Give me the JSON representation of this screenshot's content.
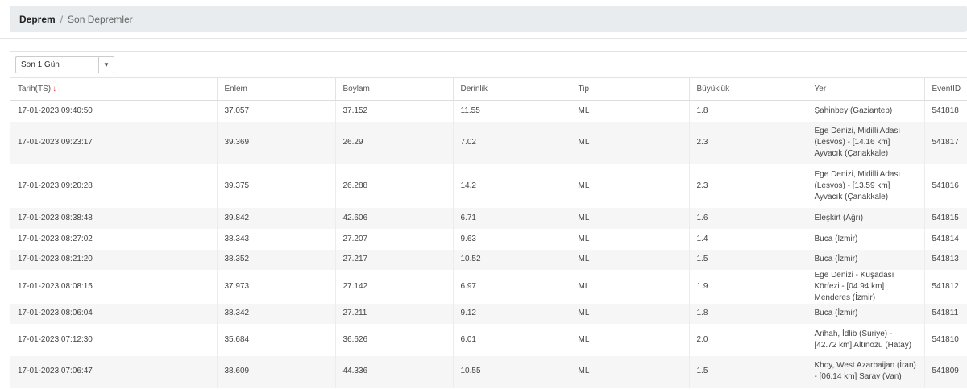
{
  "breadcrumb": {
    "home": "Deprem",
    "separator": "/",
    "current": "Son Depremler"
  },
  "filter": {
    "selected": "Son 1 Gün"
  },
  "table": {
    "columns": [
      "Tarih(TS)",
      "Enlem",
      "Boylam",
      "Derinlik",
      "Tip",
      "Büyüklük",
      "Yer",
      "EventID"
    ],
    "sort_indicator": "↓",
    "rows": [
      [
        "17-01-2023 09:40:50",
        "37.057",
        "37.152",
        "11.55",
        "ML",
        "1.8",
        "Şahinbey (Gaziantep)",
        "541818"
      ],
      [
        "17-01-2023 09:23:17",
        "39.369",
        "26.29",
        "7.02",
        "ML",
        "2.3",
        "Ege Denizi, Midilli Adası (Lesvos) - [14.16 km] Ayvacık (Çanakkale)",
        "541817"
      ],
      [
        "17-01-2023 09:20:28",
        "39.375",
        "26.288",
        "14.2",
        "ML",
        "2.3",
        "Ege Denizi, Midilli Adası (Lesvos) - [13.59 km] Ayvacık (Çanakkale)",
        "541816"
      ],
      [
        "17-01-2023 08:38:48",
        "39.842",
        "42.606",
        "6.71",
        "ML",
        "1.6",
        "Eleşkirt (Ağrı)",
        "541815"
      ],
      [
        "17-01-2023 08:27:02",
        "38.343",
        "27.207",
        "9.63",
        "ML",
        "1.4",
        "Buca (İzmir)",
        "541814"
      ],
      [
        "17-01-2023 08:21:20",
        "38.352",
        "27.217",
        "10.52",
        "ML",
        "1.5",
        "Buca (İzmir)",
        "541813"
      ],
      [
        "17-01-2023 08:08:15",
        "37.973",
        "27.142",
        "6.97",
        "ML",
        "1.9",
        "Ege Denizi - Kuşadası Körfezi - [04.94 km] Menderes (İzmir)",
        "541812"
      ],
      [
        "17-01-2023 08:06:04",
        "38.342",
        "27.211",
        "9.12",
        "ML",
        "1.8",
        "Buca (İzmir)",
        "541811"
      ],
      [
        "17-01-2023 07:12:30",
        "35.684",
        "36.626",
        "6.01",
        "ML",
        "2.0",
        "Arihah, İdlib (Suriye) - [42.72 km] Altınözü (Hatay)",
        "541810"
      ],
      [
        "17-01-2023 07:06:47",
        "38.609",
        "44.336",
        "10.55",
        "ML",
        "1.5",
        "Khoy, West Azarbaijan (İran) - [06.14 km] Saray (Van)",
        "541809"
      ]
    ]
  },
  "colors": {
    "sort_arrow": "#d9534f",
    "breadcrumb_bg": "#e9ecef",
    "row_stripe": "#f6f6f6"
  }
}
